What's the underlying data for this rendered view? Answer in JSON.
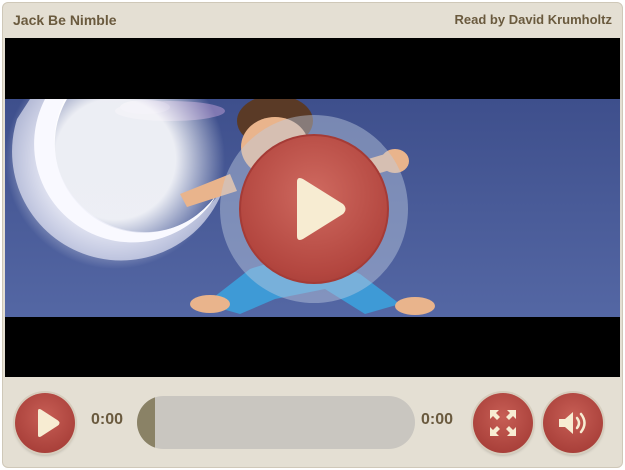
{
  "header": {
    "title": "Jack Be Nimble",
    "reader": "Read by David Krumholtz"
  },
  "video": {
    "big_play_icon": "play-icon"
  },
  "controls": {
    "play_icon": "play-icon",
    "current_time": "0:00",
    "duration": "0:00",
    "progress": 0.0,
    "fullscreen_icon": "fullscreen-icon",
    "volume_icon": "volume-icon"
  },
  "colors": {
    "panel": "#e4dfd3",
    "button_red": "#b3463f",
    "text_brown": "#6a5a3e",
    "night_sky": "#4a5c96"
  }
}
